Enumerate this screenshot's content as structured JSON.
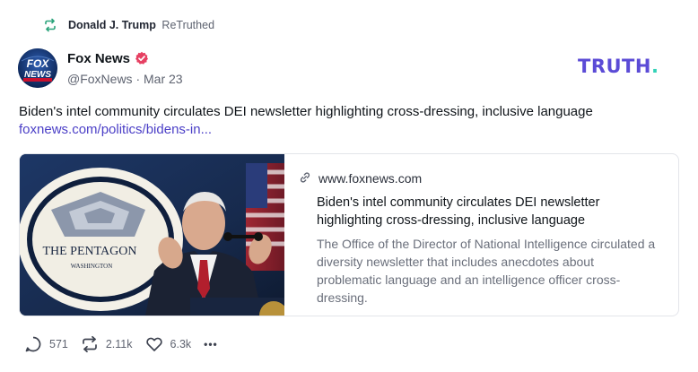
{
  "retruth": {
    "user_name": "Donald J. Trump",
    "action_label": "ReTruthed"
  },
  "author": {
    "display_name": "Fox News",
    "handle": "@FoxNews",
    "separator": "·",
    "date": "Mar 23",
    "avatar_text_top": "FOX",
    "avatar_text_bottom": "NEWS"
  },
  "brand": {
    "logo_text": "TRUTH",
    "logo_dot": ".",
    "colors": {
      "primary": "#5b4bd6",
      "accent": "#32d2b7"
    }
  },
  "post": {
    "text": "Biden's intel community circulates DEI newsletter highlighting cross-dressing, inclusive language",
    "link": "foxnews.com/politics/bidens-in..."
  },
  "card": {
    "domain": "www.foxnews.com",
    "title": "Biden's intel community circulates DEI newsletter highlighting cross-dressing, inclusive language",
    "description": "The Office of the Director of National Intelligence circulated a diversity newsletter that includes anecdotes about problematic language and an intelligence officer cross-dressing.",
    "image_sign_text": "THE PENTAGON",
    "image_sign_subtext": "WASHINGTON"
  },
  "actions": {
    "replies": "571",
    "retruths": "2.11k",
    "likes": "6.3k",
    "more_label": "•••"
  },
  "icons": {
    "retruth": "retruth-icon",
    "verified": "verified-badge-icon",
    "link": "link-icon",
    "reply": "reply-icon",
    "like": "heart-icon",
    "more": "more-icon"
  }
}
